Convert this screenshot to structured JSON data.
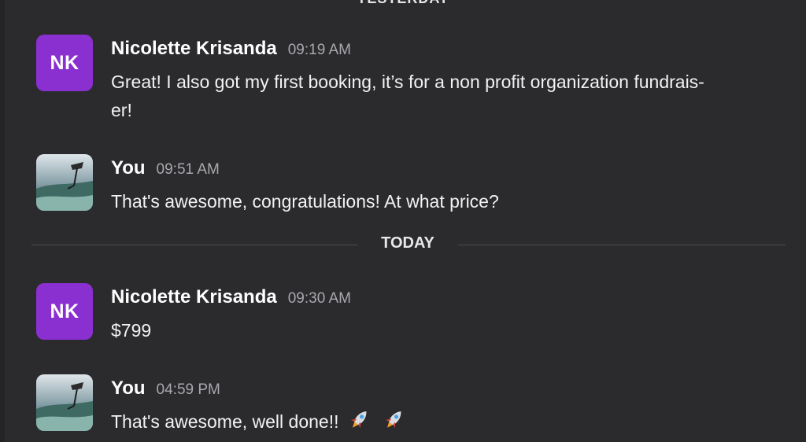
{
  "top_divider": {
    "label": "YESTERDAY"
  },
  "divider_today": {
    "label": "TODAY"
  },
  "messages": [
    {
      "avatar": {
        "type": "initials",
        "initials": "NK",
        "color": "#8a2fd0"
      },
      "name": "Nicolette Krisanda",
      "time": "09:19 AM",
      "text": "Great! I also got my first booking, it’s for a non profit organization fundrais-er!"
    },
    {
      "avatar": {
        "type": "photo",
        "icon": "user-photo-avatar"
      },
      "name": "You",
      "time": "09:51 AM",
      "text": "That's awesome, congratulations! At what price?"
    },
    {
      "avatar": {
        "type": "initials",
        "initials": "NK",
        "color": "#8a2fd0"
      },
      "name": "Nicolette Krisanda",
      "time": "09:30 AM",
      "text": "$799"
    },
    {
      "avatar": {
        "type": "photo",
        "icon": "user-photo-avatar"
      },
      "name": "You",
      "time": "04:59 PM",
      "text": "That's awesome, well done!!",
      "emoji": [
        "rocket-icon",
        "rocket-icon"
      ]
    }
  ]
}
